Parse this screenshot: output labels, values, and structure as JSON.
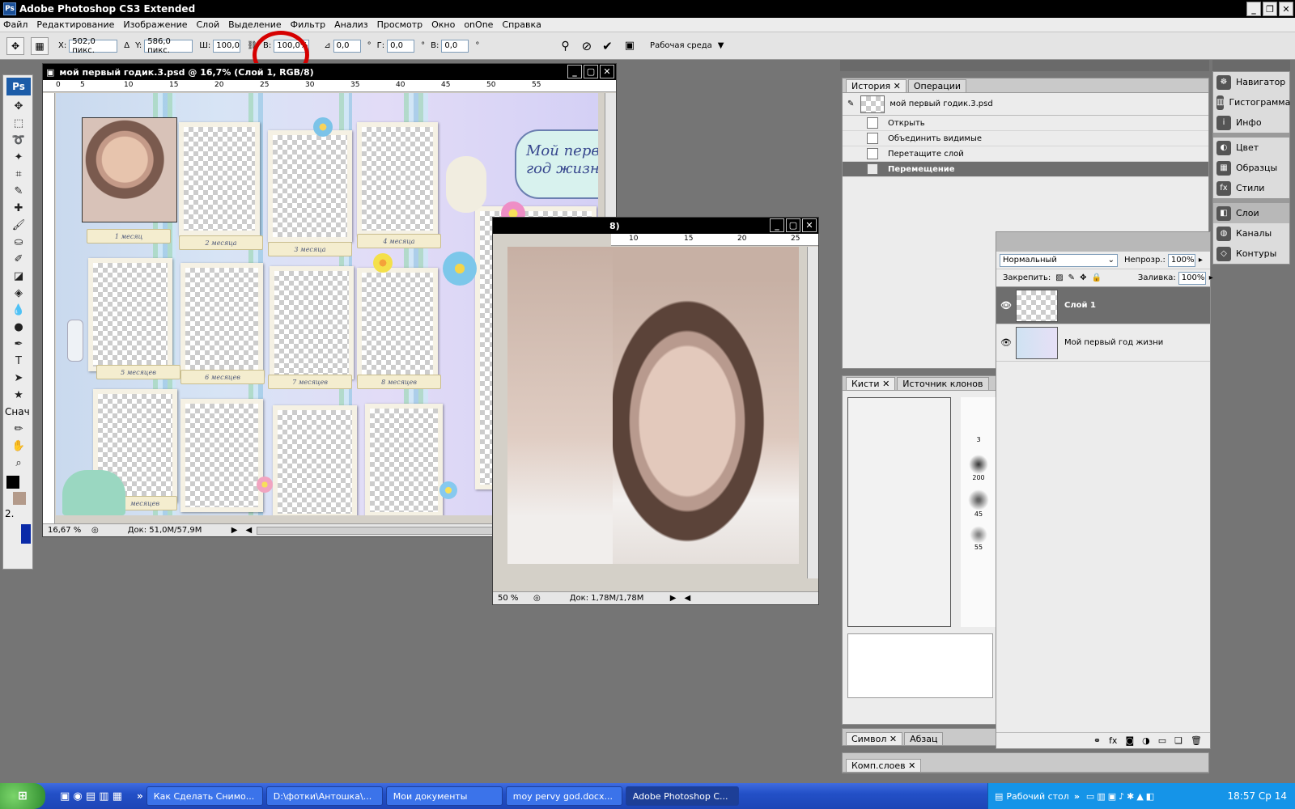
{
  "app": {
    "title": "Adobe Photoshop CS3 Extended",
    "badge": "Ps"
  },
  "window_controls": [
    "_",
    "❐",
    "✕"
  ],
  "menu": [
    "Файл",
    "Редактирование",
    "Изображение",
    "Слой",
    "Выделение",
    "Фильтр",
    "Анализ",
    "Просмотр",
    "Окно",
    "onOne",
    "Справка"
  ],
  "options": {
    "x_label": "X:",
    "x_value": "502,0 пикс.",
    "y_label": "Y:",
    "y_value": "586,0 пикс.",
    "w_label": "Ш:",
    "w_value": "100,0",
    "h_label": "В:",
    "h_value": "100,0%",
    "angle_value": "0,0",
    "angle_unit": "°",
    "hskew_label": "Г:",
    "hskew_value": "0,0",
    "vskew_label": "В:",
    "vskew_value": "0,0",
    "workspace": "Рабочая среда"
  },
  "toolbox": {
    "logo": "Ps",
    "text_tool": "T",
    "snap_text": "Снач",
    "num": "2."
  },
  "doc1": {
    "title": "мой первый годик.3.psd @ 16,7% (Слой 1, RGB/8)",
    "zoom": "16,67 %",
    "doc_size": "Док: 51,0M/57,9M",
    "ruler": [
      "0",
      "5",
      "10",
      "15",
      "20",
      "25",
      "30",
      "35",
      "40",
      "45",
      "50",
      "55"
    ],
    "ribbons": [
      "1 месяц",
      "2 месяца",
      "3 месяца",
      "4 месяца",
      "5 месяцев",
      "6 месяцев",
      "7 месяцев",
      "8 месяцев",
      "месяцев"
    ],
    "banner": [
      "Мой перв",
      "год жизн"
    ]
  },
  "doc2": {
    "title": "8)",
    "zoom": "50 %",
    "doc_size": "Док: 1,78M/1,78M",
    "ruler": [
      "10",
      "15",
      "20",
      "25"
    ]
  },
  "history": {
    "tabs": [
      "История",
      "Операции"
    ],
    "snapshot": "мой первый годик.3.psd",
    "steps": [
      "Открыть",
      "Объединить видимые",
      "Перетащите слой",
      "Перемещение"
    ],
    "selected": 3
  },
  "side_panels": [
    {
      "label": "Навигатор",
      "icon": "☸"
    },
    {
      "label": "Гистограмма",
      "icon": "▥"
    },
    {
      "label": "Инфо",
      "icon": "i"
    },
    {
      "label": "Цвет",
      "icon": "◐"
    },
    {
      "label": "Образцы",
      "icon": "▦"
    },
    {
      "label": "Стили",
      "icon": "fx"
    },
    {
      "label": "Слои",
      "icon": "◧"
    },
    {
      "label": "Каналы",
      "icon": "◍"
    },
    {
      "label": "Контуры",
      "icon": "◇"
    }
  ],
  "layers": {
    "blend": "Нормальный",
    "opacity_label": "Непрозр.:",
    "opacity": "100%",
    "lock_label": "Закрепить:",
    "fill_label": "Заливка:",
    "fill": "100%",
    "items": [
      "Слой 1",
      "Мой первый год жизни"
    ],
    "selected": 0
  },
  "brushes": {
    "tabs": [
      "Кисти",
      "Источник клонов"
    ],
    "sizes": [
      "3",
      "200",
      "45",
      "55"
    ]
  },
  "char_tabs": [
    "Символ",
    "Абзац"
  ],
  "comp_tab": "Комп.слоев",
  "taskbar": {
    "tasks": [
      "Как Сделать Снимо...",
      "D:\\фотки\\Антошка\\...",
      "Мои документы",
      "moy pervy god.docx...",
      "Adobe Photoshop C..."
    ],
    "desktop": "Рабочий стол",
    "clock": "18:57 Ср 14"
  }
}
